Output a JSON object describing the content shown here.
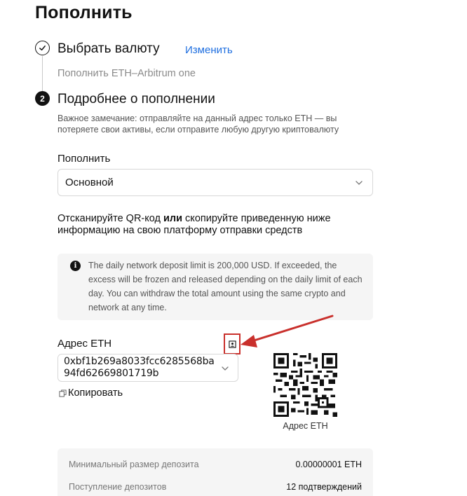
{
  "page": {
    "title": "Пополнить"
  },
  "step1": {
    "title": "Выбрать валюту",
    "change_label": "Изменить",
    "summary": "Пополнить ETH–Arbitrum one"
  },
  "step2": {
    "number": "2",
    "title": "Подробнее о пополнении",
    "notice": "Важное замечание: отправляйте на данный адрес только ETH — вы потеряете свои активы, если отправите любую другую криптовалюту"
  },
  "account": {
    "label": "Пополнить",
    "selected": "Основной"
  },
  "scan": {
    "before": "Отсканируйте QR-код ",
    "bold": "или",
    "after": " скопируйте приведенную ниже информацию на свою платформу отправки средств"
  },
  "info": {
    "icon": "i",
    "text": "The daily network deposit limit is 200,000 USD. If exceeded, the excess will be frozen and released depending on the daily limit of each day. You can withdraw the total amount using the same crypto and network at any time."
  },
  "address": {
    "label": "Адрес ETH",
    "value": "0xbf1b269a8033fcc6285568ba94fd62669801719b",
    "copy_label": "Копировать",
    "qr_caption": "Адрес ETH"
  },
  "details": [
    {
      "key": "Минимальный размер депозита",
      "value": "0.00000001 ETH"
    },
    {
      "key": "Поступление депозитов",
      "value": "12 подтверждений"
    }
  ],
  "colors": {
    "accent_link": "#1f6fe0",
    "annotation_red": "#c9302c",
    "text_primary": "#121212",
    "panel_bg": "#f5f5f5"
  }
}
